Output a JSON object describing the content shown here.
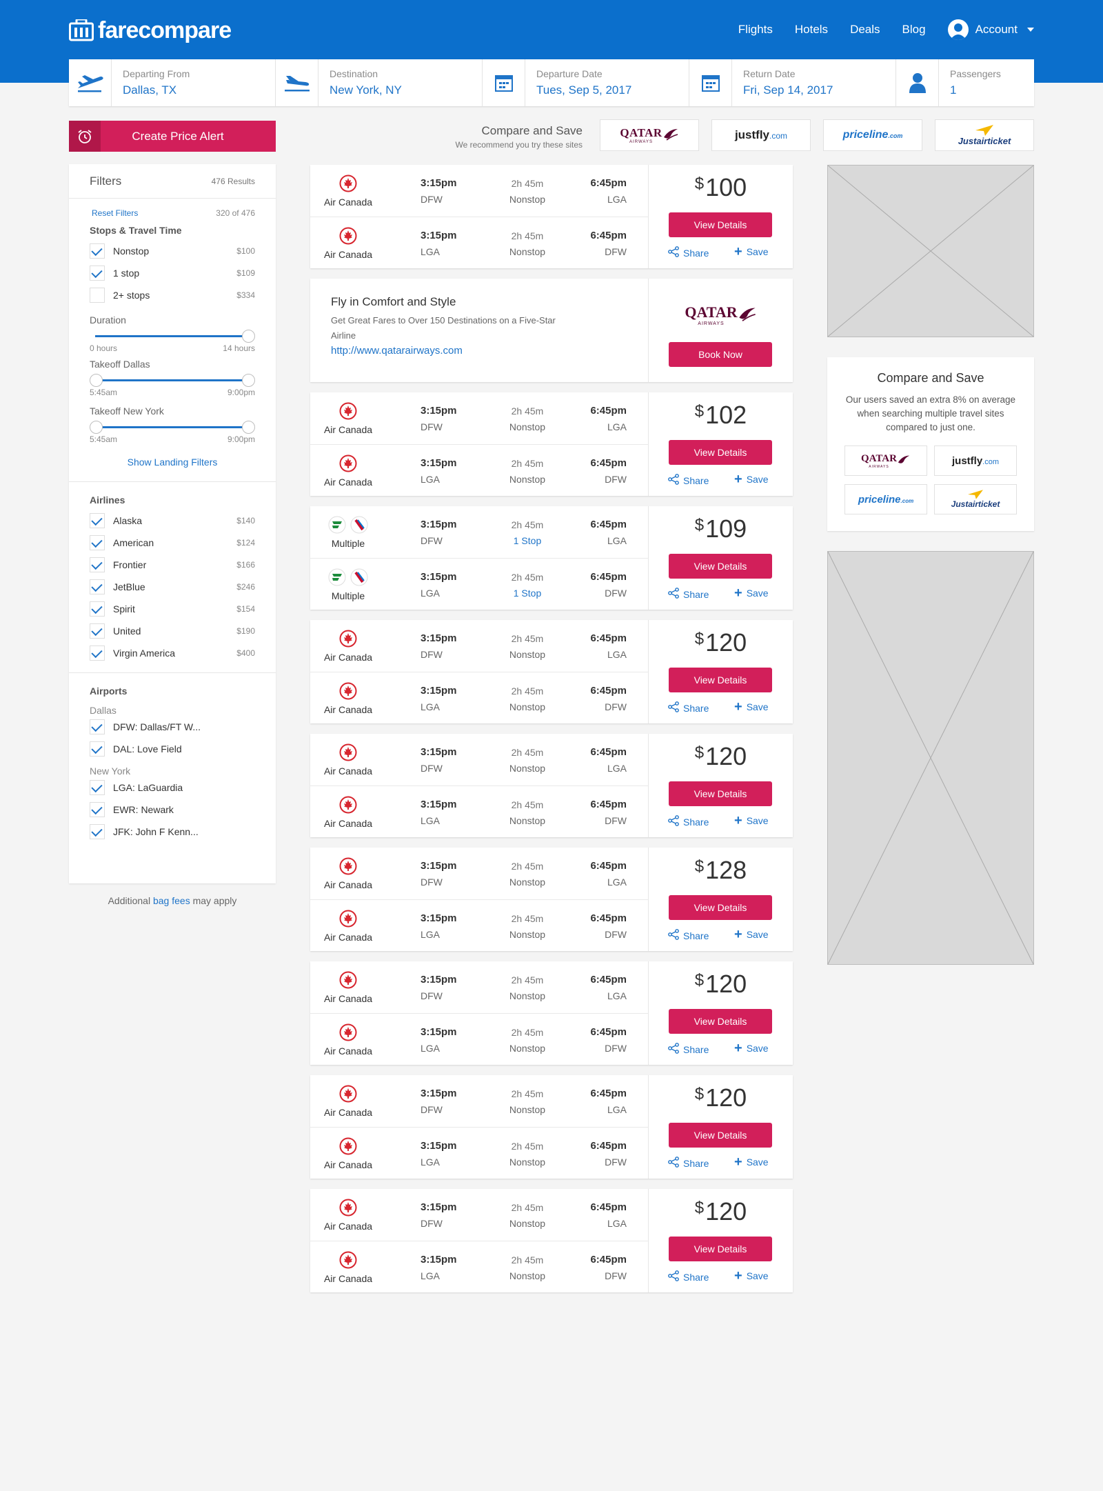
{
  "brand": {
    "name": "farecompare",
    "primary": "#0b6fcc",
    "accent": "#d21f5a",
    "link": "#1f74c8"
  },
  "nav": {
    "flights": "Flights",
    "hotels": "Hotels",
    "deals": "Deals",
    "blog": "Blog",
    "account": "Account"
  },
  "search": {
    "from_label": "Departing From",
    "from_value": "Dallas, TX",
    "to_label": "Destination",
    "to_value": "New York, NY",
    "depart_label": "Departure Date",
    "depart_value": "Tues, Sep 5, 2017",
    "return_label": "Return Date",
    "return_value": "Fri, Sep 14, 2017",
    "pax_label": "Passengers",
    "pax_value": "1"
  },
  "alert": {
    "label": "Create Price Alert"
  },
  "compare_top": {
    "title": "Compare and Save",
    "subtitle": "We recommend you try these sites"
  },
  "partners": {
    "qatar": "QATAR",
    "qatar_sub": "AIRWAYS",
    "justfly": "justfly",
    "justfly_tld": ".com",
    "priceline": "priceline",
    "priceline_tld": ".com",
    "justairticket": "Justairticket"
  },
  "filters": {
    "title": "Filters",
    "results": "476 Results",
    "reset": "Reset Filters",
    "matching": "320 of 476",
    "stops_title": "Stops & Travel Time",
    "stops": [
      {
        "label": "Nonstop",
        "price": "$100",
        "checked": true
      },
      {
        "label": "1 stop",
        "price": "$109",
        "checked": true
      },
      {
        "label": "2+ stops",
        "price": "$334",
        "checked": false
      }
    ],
    "duration": {
      "label": "Duration",
      "min": "0 hours",
      "max": "14 hours"
    },
    "takeoff_dallas": {
      "label": "Takeoff Dallas",
      "min": "5:45am",
      "max": "9:00pm"
    },
    "takeoff_ny": {
      "label": "Takeoff New York",
      "min": "5:45am",
      "max": "9:00pm"
    },
    "show_landing": "Show Landing Filters",
    "airlines_title": "Airlines",
    "airlines": [
      {
        "label": "Alaska",
        "price": "$140"
      },
      {
        "label": "American",
        "price": "$124"
      },
      {
        "label": "Frontier",
        "price": "$166"
      },
      {
        "label": "JetBlue",
        "price": "$246"
      },
      {
        "label": "Spirit",
        "price": "$154"
      },
      {
        "label": "United",
        "price": "$190"
      },
      {
        "label": "Virgin America",
        "price": "$400"
      }
    ],
    "airports_title": "Airports",
    "dallas_label": "Dallas",
    "dallas_airports": [
      {
        "label": "DFW: Dallas/FT W..."
      },
      {
        "label": "DAL: Love Field"
      }
    ],
    "ny_label": "New York",
    "ny_airports": [
      {
        "label": "LGA: LaGuardia"
      },
      {
        "label": "EWR: Newark"
      },
      {
        "label": "JFK: John F Kenn..."
      }
    ]
  },
  "bag_fees": {
    "pre": "Additional",
    "link": "bag fees",
    "post": "may apply"
  },
  "card_common": {
    "view": "View Details",
    "share": "Share",
    "save": "Save",
    "currency": "$"
  },
  "ad": {
    "title": "Fly in Comfort and Style",
    "subtitle": "Get Great Fares to Over 150 Destinations on a Five-Star Airline",
    "link": "http://www.qatarairways.com",
    "button": "Book Now"
  },
  "flights": [
    {
      "price": "100",
      "airline": "Air Canada",
      "multi": false,
      "outbound": {
        "dep_time": "3:15pm",
        "dep_ap": "DFW",
        "duration": "2h 45m",
        "stops": "Nonstop",
        "arr_time": "6:45pm",
        "arr_ap": "LGA"
      },
      "return": {
        "dep_time": "3:15pm",
        "dep_ap": "LGA",
        "duration": "2h 45m",
        "stops": "Nonstop",
        "arr_time": "6:45pm",
        "arr_ap": "DFW"
      }
    },
    {
      "price": "102",
      "airline": "Air Canada",
      "multi": false,
      "outbound": {
        "dep_time": "3:15pm",
        "dep_ap": "DFW",
        "duration": "2h 45m",
        "stops": "Nonstop",
        "arr_time": "6:45pm",
        "arr_ap": "LGA"
      },
      "return": {
        "dep_time": "3:15pm",
        "dep_ap": "LGA",
        "duration": "2h 45m",
        "stops": "Nonstop",
        "arr_time": "6:45pm",
        "arr_ap": "DFW"
      }
    },
    {
      "price": "109",
      "airline": "Multiple",
      "multi": true,
      "outbound": {
        "dep_time": "3:15pm",
        "dep_ap": "DFW",
        "duration": "2h 45m",
        "stops": "1 Stop",
        "arr_time": "6:45pm",
        "arr_ap": "LGA"
      },
      "return": {
        "dep_time": "3:15pm",
        "dep_ap": "LGA",
        "duration": "2h 45m",
        "stops": "1 Stop",
        "arr_time": "6:45pm",
        "arr_ap": "DFW"
      }
    },
    {
      "price": "120",
      "airline": "Air Canada",
      "multi": false,
      "outbound": {
        "dep_time": "3:15pm",
        "dep_ap": "DFW",
        "duration": "2h 45m",
        "stops": "Nonstop",
        "arr_time": "6:45pm",
        "arr_ap": "LGA"
      },
      "return": {
        "dep_time": "3:15pm",
        "dep_ap": "LGA",
        "duration": "2h 45m",
        "stops": "Nonstop",
        "arr_time": "6:45pm",
        "arr_ap": "DFW"
      }
    },
    {
      "price": "120",
      "airline": "Air Canada",
      "multi": false,
      "outbound": {
        "dep_time": "3:15pm",
        "dep_ap": "DFW",
        "duration": "2h 45m",
        "stops": "Nonstop",
        "arr_time": "6:45pm",
        "arr_ap": "LGA"
      },
      "return": {
        "dep_time": "3:15pm",
        "dep_ap": "LGA",
        "duration": "2h 45m",
        "stops": "Nonstop",
        "arr_time": "6:45pm",
        "arr_ap": "DFW"
      }
    },
    {
      "price": "128",
      "airline": "Air Canada",
      "multi": false,
      "outbound": {
        "dep_time": "3:15pm",
        "dep_ap": "DFW",
        "duration": "2h 45m",
        "stops": "Nonstop",
        "arr_time": "6:45pm",
        "arr_ap": "LGA"
      },
      "return": {
        "dep_time": "3:15pm",
        "dep_ap": "LGA",
        "duration": "2h 45m",
        "stops": "Nonstop",
        "arr_time": "6:45pm",
        "arr_ap": "DFW"
      }
    },
    {
      "price": "120",
      "airline": "Air Canada",
      "multi": false,
      "outbound": {
        "dep_time": "3:15pm",
        "dep_ap": "DFW",
        "duration": "2h 45m",
        "stops": "Nonstop",
        "arr_time": "6:45pm",
        "arr_ap": "LGA"
      },
      "return": {
        "dep_time": "3:15pm",
        "dep_ap": "LGA",
        "duration": "2h 45m",
        "stops": "Nonstop",
        "arr_time": "6:45pm",
        "arr_ap": "DFW"
      }
    },
    {
      "price": "120",
      "airline": "Air Canada",
      "multi": false,
      "outbound": {
        "dep_time": "3:15pm",
        "dep_ap": "DFW",
        "duration": "2h 45m",
        "stops": "Nonstop",
        "arr_time": "6:45pm",
        "arr_ap": "LGA"
      },
      "return": {
        "dep_time": "3:15pm",
        "dep_ap": "LGA",
        "duration": "2h 45m",
        "stops": "Nonstop",
        "arr_time": "6:45pm",
        "arr_ap": "DFW"
      }
    },
    {
      "price": "120",
      "airline": "Air Canada",
      "multi": false,
      "outbound": {
        "dep_time": "3:15pm",
        "dep_ap": "DFW",
        "duration": "2h 45m",
        "stops": "Nonstop",
        "arr_time": "6:45pm",
        "arr_ap": "LGA"
      },
      "return": {
        "dep_time": "3:15pm",
        "dep_ap": "LGA",
        "duration": "2h 45m",
        "stops": "Nonstop",
        "arr_time": "6:45pm",
        "arr_ap": "DFW"
      }
    }
  ],
  "compare_box": {
    "title": "Compare and Save",
    "text": "Our users saved an extra 8% on average when searching multiple travel sites compared to just one."
  }
}
